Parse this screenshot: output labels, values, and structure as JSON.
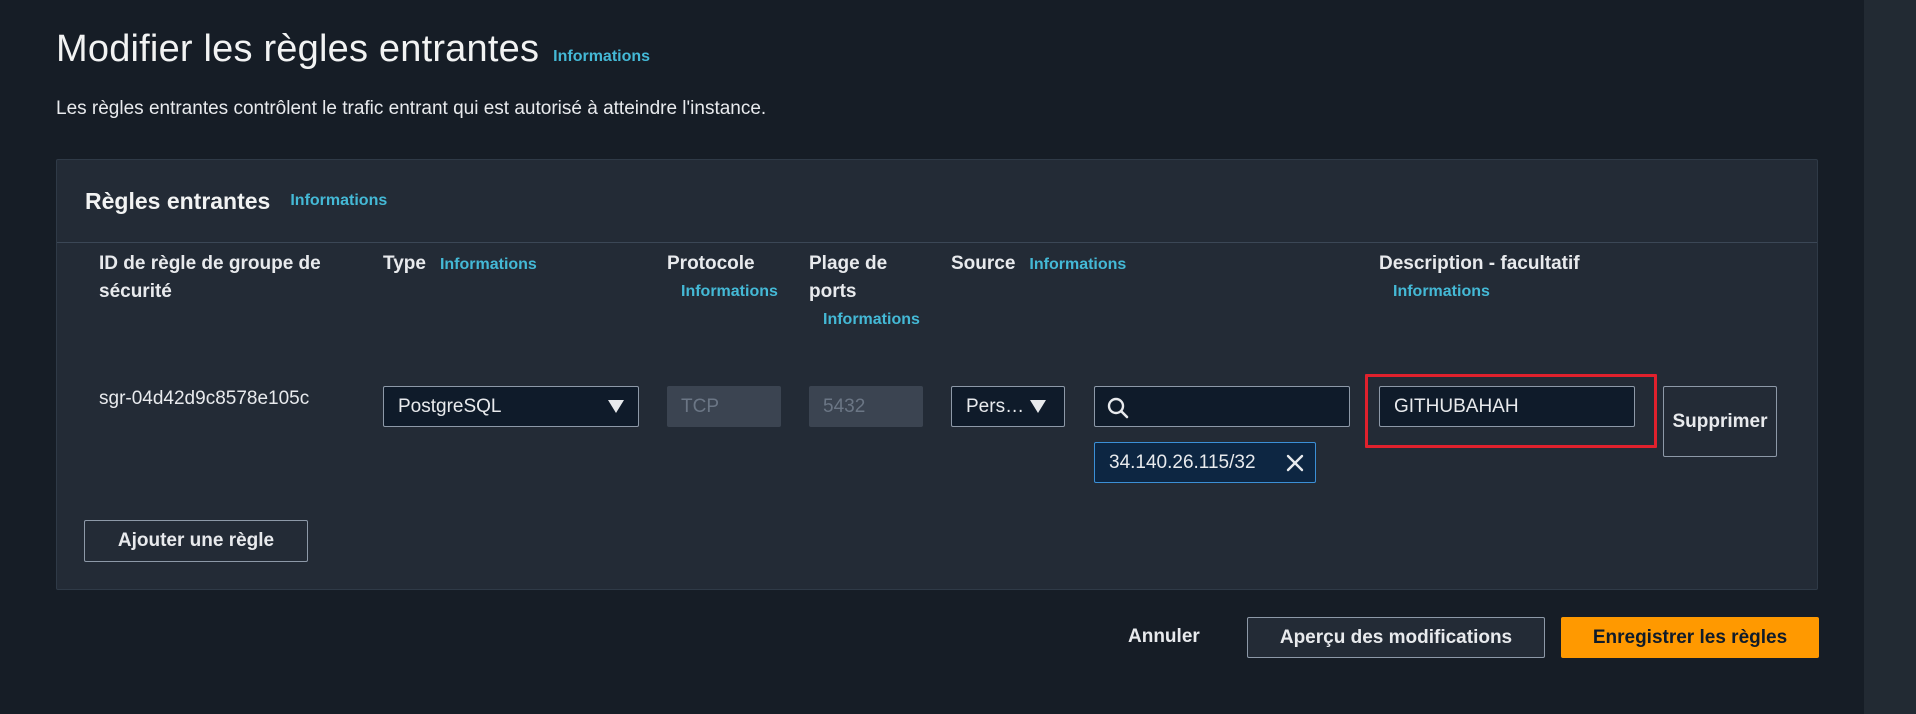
{
  "page": {
    "title": "Modifier les règles entrantes",
    "title_info": "Informations",
    "description": "Les règles entrantes contrôlent le trafic entrant qui est autorisé à atteindre l'instance."
  },
  "panel": {
    "title": "Règles entrantes",
    "info": "Informations",
    "columns": {
      "rule_id": "ID de règle de groupe de sécurité",
      "type": "Type",
      "type_info": "Informations",
      "protocol": "Protocole",
      "protocol_info": "Informations",
      "port_range": "Plage de ports",
      "port_info": "Informations",
      "source": "Source",
      "source_info": "Informations",
      "description": "Description - facultatif",
      "description_info": "Informations"
    },
    "rule": {
      "id": "sgr-04d42d9c8578e105c",
      "type": "PostgreSQL",
      "protocol": "TCP",
      "port": "5432",
      "source_type": "Pers…",
      "source_search": "",
      "source_token": "34.140.26.115/32",
      "description": "GITHUBAHAH",
      "delete_label": "Supprimer"
    },
    "add_rule": "Ajouter une règle"
  },
  "footer": {
    "cancel": "Annuler",
    "preview": "Aperçu des modifications",
    "save": "Enregistrer les règles"
  },
  "colors": {
    "accent": "#ff9900",
    "link": "#44b9d6",
    "highlight": "#e0212d"
  }
}
